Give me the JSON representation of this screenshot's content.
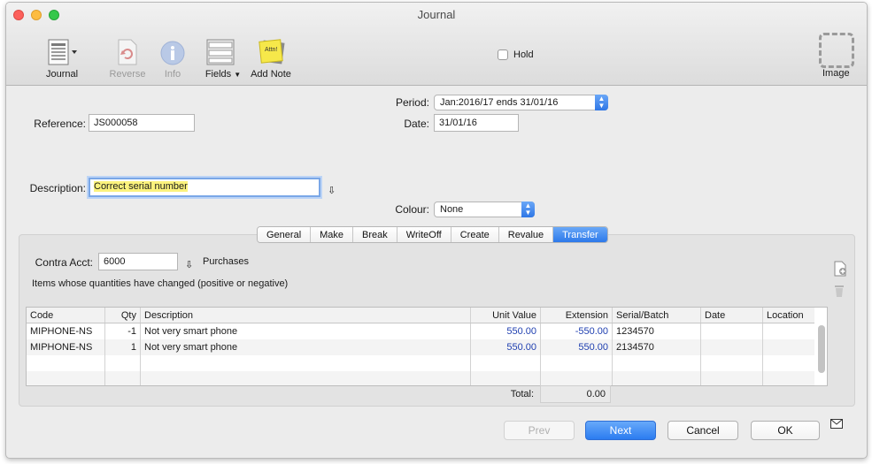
{
  "window": {
    "title": "Journal"
  },
  "toolbar": {
    "journal_label": "Journal",
    "reverse_label": "Reverse",
    "info_label": "Info",
    "fields_label": "Fields",
    "add_note_label": "Add Note",
    "note_icon_text": "Attn!",
    "hold_label": "Hold",
    "image_label": "Image"
  },
  "form": {
    "reference_label": "Reference:",
    "reference_value": "JS000058",
    "period_label": "Period:",
    "period_value": "Jan:2016/17 ends 31/01/16",
    "date_label": "Date:",
    "date_value": "31/01/16",
    "description_label": "Description:",
    "description_value": "Correct serial number",
    "colour_label": "Colour:",
    "colour_value": "None"
  },
  "tabs": [
    "General",
    "Make",
    "Break",
    "WriteOff",
    "Create",
    "Revalue",
    "Transfer"
  ],
  "active_tab": "Transfer",
  "transfer": {
    "contra_label": "Contra Acct:",
    "contra_value": "6000",
    "contra_name": "Purchases",
    "note": "Items whose quantities have changed (positive or negative)"
  },
  "table": {
    "columns": [
      "Code",
      "Qty",
      "Description",
      "Unit Value",
      "Extension",
      "Serial/Batch",
      "Date",
      "Location"
    ],
    "rows": [
      {
        "code": "MIPHONE-NS",
        "qty": "-1",
        "description": "Not very smart phone",
        "unit_value": "550.00",
        "extension": "-550.00",
        "serial": "1234570",
        "date": "",
        "location": ""
      },
      {
        "code": "MIPHONE-NS",
        "qty": "1",
        "description": "Not very smart phone",
        "unit_value": "550.00",
        "extension": "550.00",
        "serial": "2134570",
        "date": "",
        "location": ""
      }
    ],
    "total_label": "Total:",
    "total_value": "0.00"
  },
  "buttons": {
    "prev": "Prev",
    "next": "Next",
    "cancel": "Cancel",
    "ok": "OK"
  },
  "colors": {
    "accent": "#2f7bf0",
    "highlight": "#fbf27d",
    "link_blue": "#1f3fb0"
  }
}
